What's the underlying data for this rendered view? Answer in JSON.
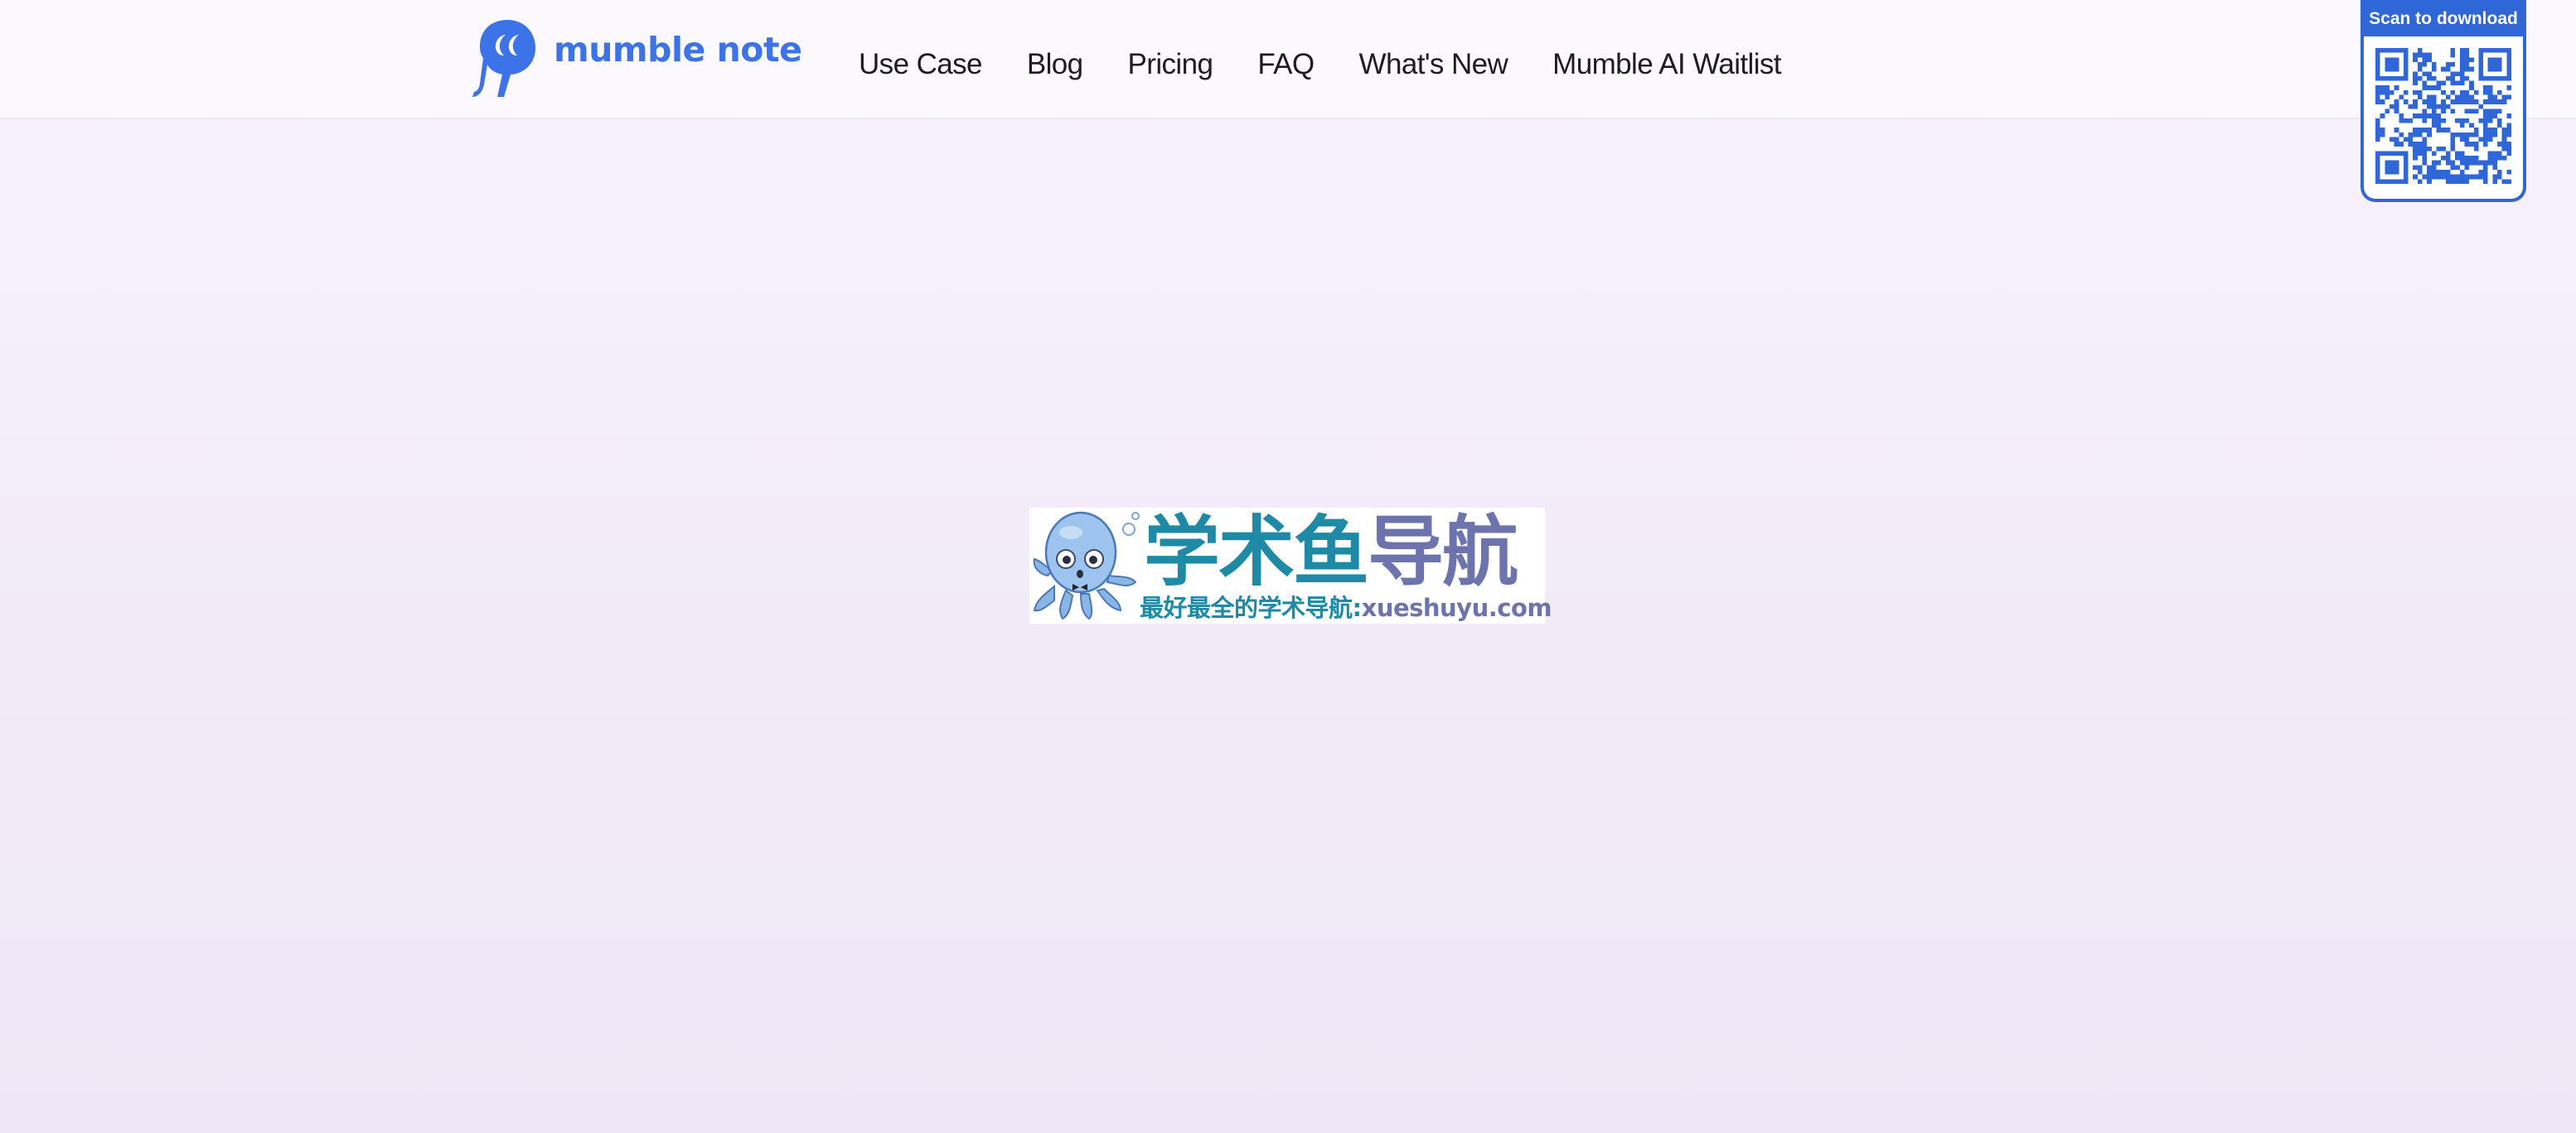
{
  "header": {
    "logo_text": "mumble note",
    "nav": [
      {
        "label": "Use Case"
      },
      {
        "label": "Blog"
      },
      {
        "label": "Pricing"
      },
      {
        "label": "FAQ"
      },
      {
        "label": "What's New"
      },
      {
        "label": "Mumble AI Waitlist"
      }
    ]
  },
  "qr_widget": {
    "caption": "Scan to download"
  },
  "banner": {
    "title_part1": "学术鱼",
    "title_part2": "导航",
    "subtitle_part1": "最好最全的学术导航:",
    "subtitle_part2": "xueshuyu.com"
  },
  "colors": {
    "brand_blue": "#3d73e8",
    "qr_blue": "#2f66d8",
    "banner_teal": "#1e8aa6",
    "banner_purple": "#6c73ad",
    "background": "#f2ebf7"
  }
}
